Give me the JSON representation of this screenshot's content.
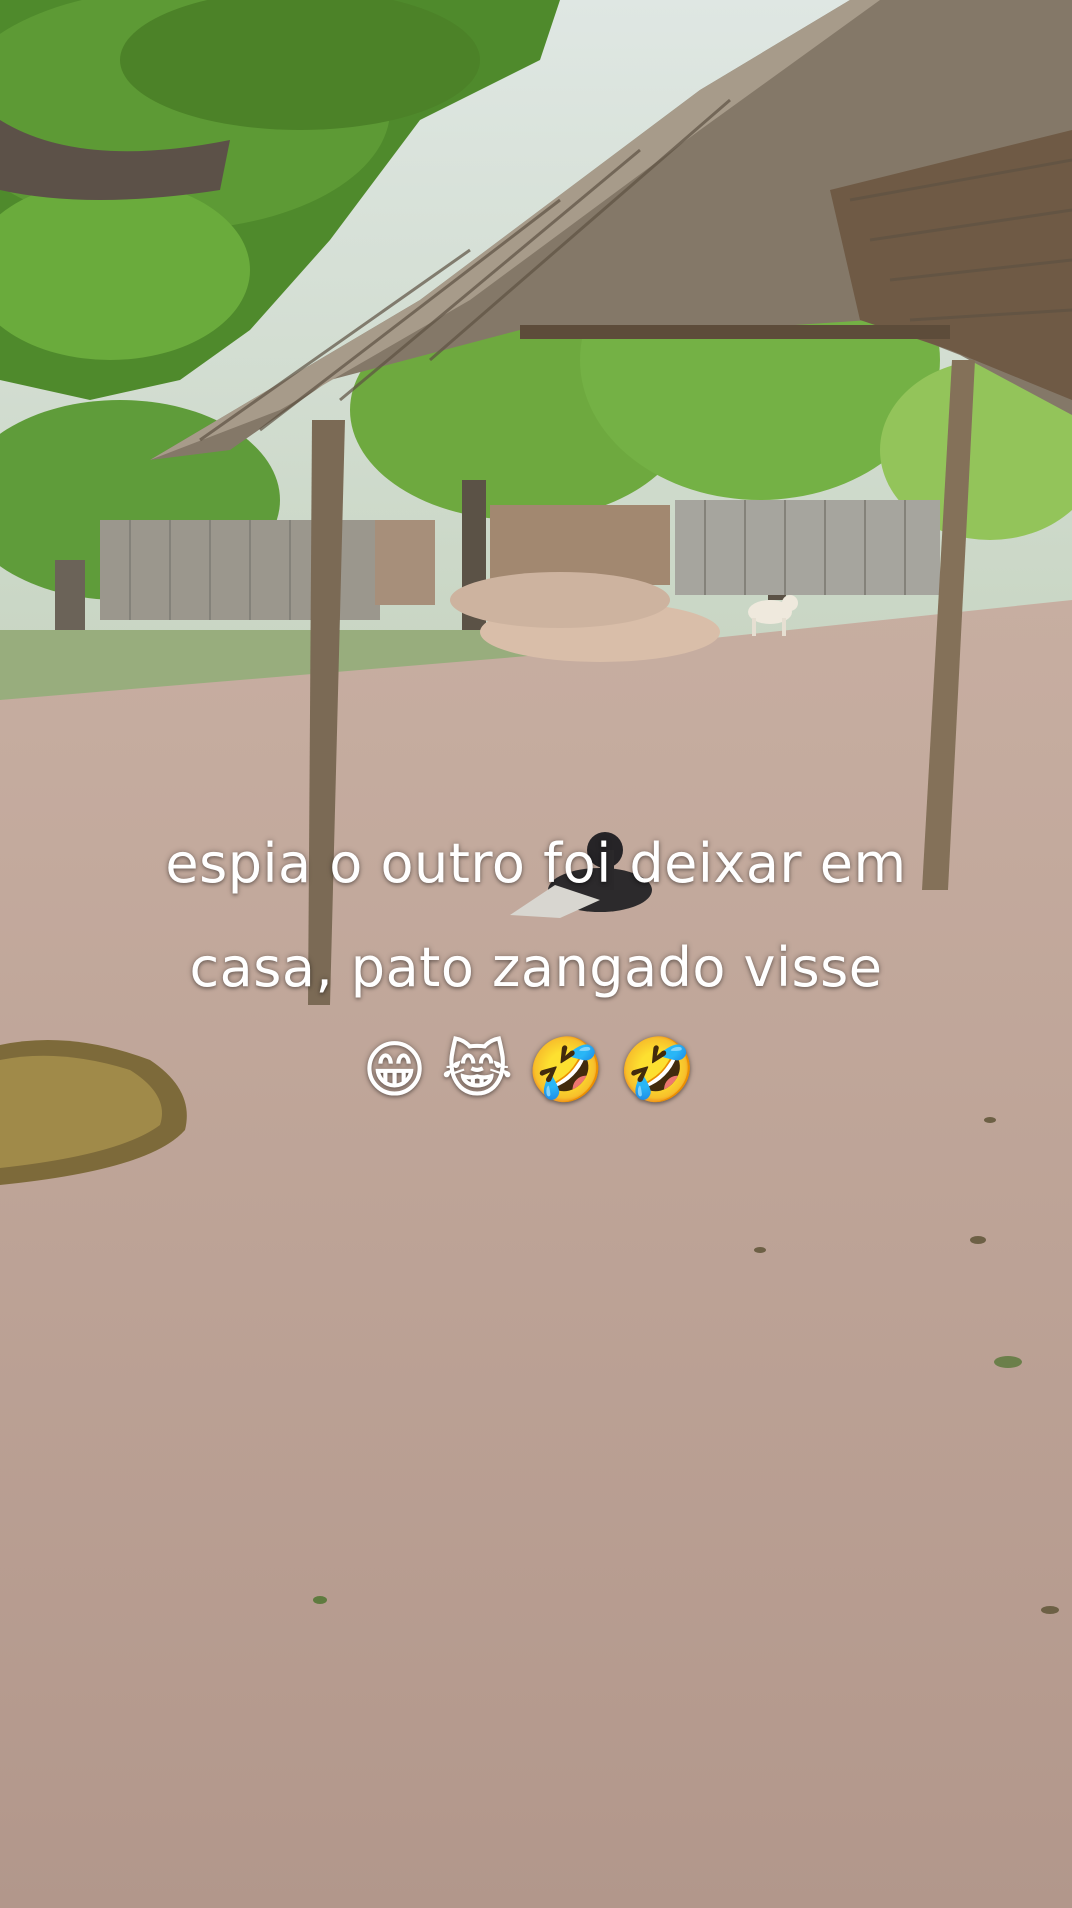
{
  "caption": {
    "line1": "espia o outro foi deixar em",
    "line2": "casa, pato zangado visse",
    "emojis": "😁😹🤣🤣"
  },
  "scene": {
    "sky": "#e9eef0",
    "foliage": "#5e9e36",
    "foliage_light": "#8cc74e",
    "ground": "#b89d92",
    "thatch": "#8a7d6c",
    "post": "#7a6a55",
    "fence": "#9a9890"
  }
}
